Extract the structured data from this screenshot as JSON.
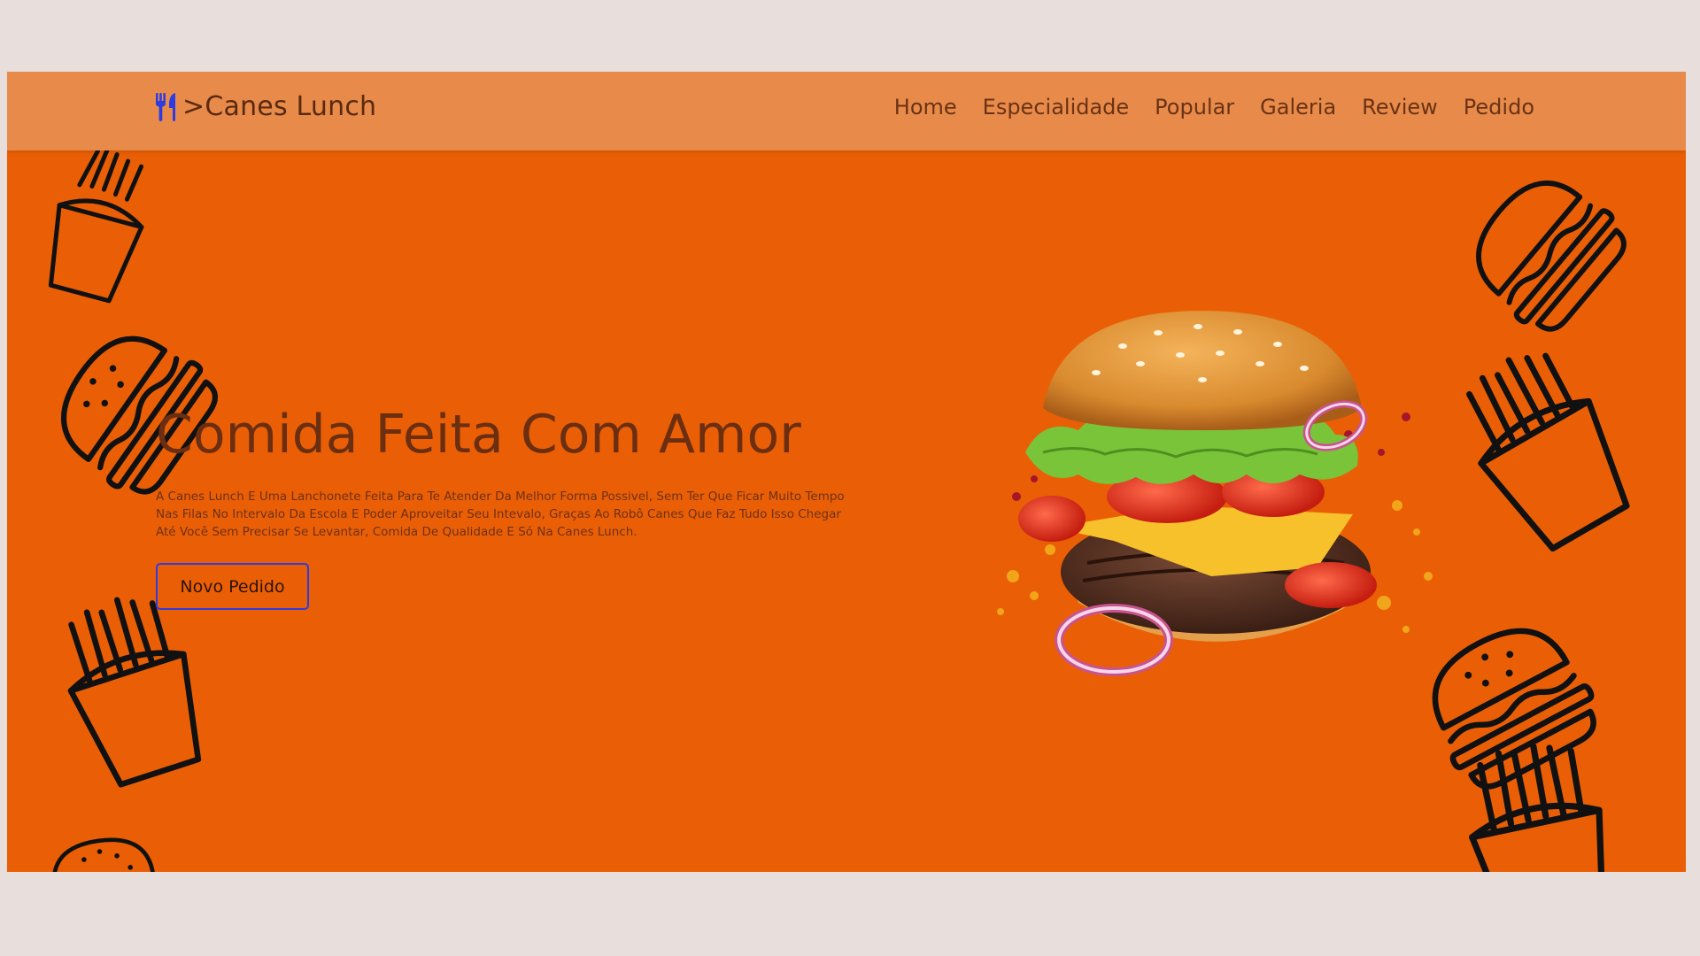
{
  "brand": {
    "icon": "fork-knife-icon",
    "name": ">Canes Lunch"
  },
  "nav": [
    {
      "label": "Home"
    },
    {
      "label": "Especialidade"
    },
    {
      "label": "Popular"
    },
    {
      "label": "Galeria"
    },
    {
      "label": "Review"
    },
    {
      "label": "Pedido"
    }
  ],
  "hero": {
    "title": "Comida Feita Com Amor",
    "description": "A Canes Lunch E Uma Lanchonete Feita Para Te Atender Da Melhor Forma Possivel, Sem Ter Que Ficar Muito Tempo Nas Filas No Intervalo Da Escola E Poder Aproveitar Seu Intevalo, Graças Ao Robô Canes Que Faz Tudo Isso Chegar Até Você Sem Precisar Se Levantar, Comida De Qualidade E Só Na Canes Lunch.",
    "cta_label": "Novo Pedido",
    "image": "flying-burger-image"
  },
  "decorations": [
    "fries-icon",
    "burger-icon"
  ],
  "colors": {
    "page_bg": "#e8dfdd",
    "hero_bg": "#ea5f06",
    "navbar_bg": "#e88b4a",
    "title": "#6b2e10",
    "accent": "#2d3be0"
  }
}
